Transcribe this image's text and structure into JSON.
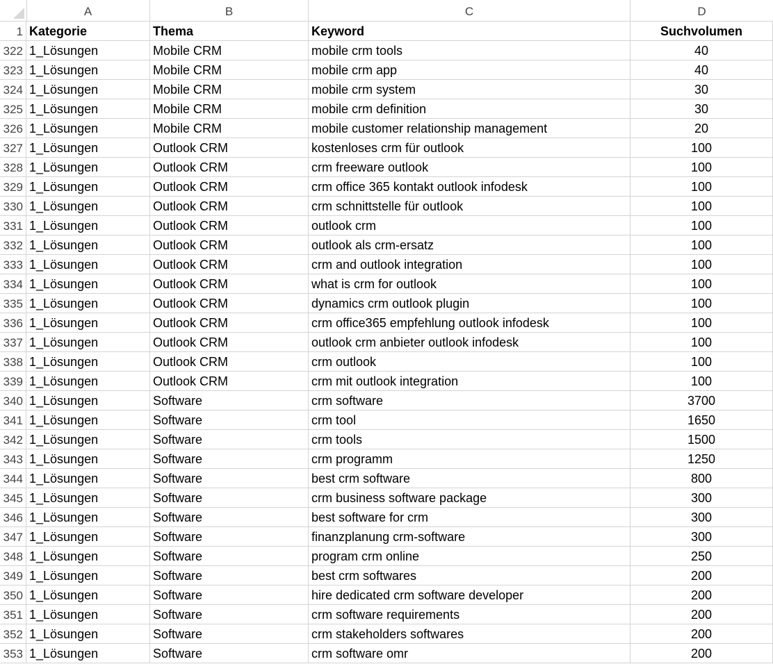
{
  "columns": [
    "A",
    "B",
    "C",
    "D"
  ],
  "header_row": {
    "row_number": "1",
    "cells": [
      "Kategorie",
      "Thema",
      "Keyword",
      "Suchvolumen"
    ]
  },
  "rows": [
    {
      "n": "322",
      "a": "1_Lösungen",
      "b": "Mobile CRM",
      "c": "mobile crm tools",
      "d": "40"
    },
    {
      "n": "323",
      "a": "1_Lösungen",
      "b": "Mobile CRM",
      "c": "mobile crm app",
      "d": "40"
    },
    {
      "n": "324",
      "a": "1_Lösungen",
      "b": "Mobile CRM",
      "c": "mobile crm system",
      "d": "30"
    },
    {
      "n": "325",
      "a": "1_Lösungen",
      "b": "Mobile CRM",
      "c": "mobile crm definition",
      "d": "30"
    },
    {
      "n": "326",
      "a": "1_Lösungen",
      "b": "Mobile CRM",
      "c": "mobile customer relationship management",
      "d": "20"
    },
    {
      "n": "327",
      "a": "1_Lösungen",
      "b": "Outlook CRM",
      "c": "kostenloses crm für outlook",
      "d": "100"
    },
    {
      "n": "328",
      "a": "1_Lösungen",
      "b": "Outlook CRM",
      "c": "crm freeware outlook",
      "d": "100"
    },
    {
      "n": "329",
      "a": "1_Lösungen",
      "b": "Outlook CRM",
      "c": "crm office 365 kontakt outlook infodesk",
      "d": "100"
    },
    {
      "n": "330",
      "a": "1_Lösungen",
      "b": "Outlook CRM",
      "c": "crm schnittstelle für outlook",
      "d": "100"
    },
    {
      "n": "331",
      "a": "1_Lösungen",
      "b": "Outlook CRM",
      "c": "outlook crm",
      "d": "100"
    },
    {
      "n": "332",
      "a": "1_Lösungen",
      "b": "Outlook CRM",
      "c": "outlook als crm-ersatz",
      "d": "100"
    },
    {
      "n": "333",
      "a": "1_Lösungen",
      "b": "Outlook CRM",
      "c": "crm and outlook integration",
      "d": "100"
    },
    {
      "n": "334",
      "a": "1_Lösungen",
      "b": "Outlook CRM",
      "c": "what is crm for outlook",
      "d": "100"
    },
    {
      "n": "335",
      "a": "1_Lösungen",
      "b": "Outlook CRM",
      "c": "dynamics crm outlook plugin",
      "d": "100"
    },
    {
      "n": "336",
      "a": "1_Lösungen",
      "b": "Outlook CRM",
      "c": "crm office365 empfehlung outlook infodesk",
      "d": "100"
    },
    {
      "n": "337",
      "a": "1_Lösungen",
      "b": "Outlook CRM",
      "c": "outlook crm anbieter outlook infodesk",
      "d": "100"
    },
    {
      "n": "338",
      "a": "1_Lösungen",
      "b": "Outlook CRM",
      "c": "crm outlook",
      "d": "100"
    },
    {
      "n": "339",
      "a": "1_Lösungen",
      "b": "Outlook CRM",
      "c": "crm mit outlook integration",
      "d": "100"
    },
    {
      "n": "340",
      "a": "1_Lösungen",
      "b": "Software",
      "c": "crm software",
      "d": "3700"
    },
    {
      "n": "341",
      "a": "1_Lösungen",
      "b": "Software",
      "c": "crm tool",
      "d": "1650"
    },
    {
      "n": "342",
      "a": "1_Lösungen",
      "b": "Software",
      "c": "crm tools",
      "d": "1500"
    },
    {
      "n": "343",
      "a": "1_Lösungen",
      "b": "Software",
      "c": "crm programm",
      "d": "1250"
    },
    {
      "n": "344",
      "a": "1_Lösungen",
      "b": "Software",
      "c": "best crm software",
      "d": "800"
    },
    {
      "n": "345",
      "a": "1_Lösungen",
      "b": "Software",
      "c": "crm business software package",
      "d": "300"
    },
    {
      "n": "346",
      "a": "1_Lösungen",
      "b": "Software",
      "c": "best software for crm",
      "d": "300"
    },
    {
      "n": "347",
      "a": "1_Lösungen",
      "b": "Software",
      "c": "finanzplanung crm-software",
      "d": "300"
    },
    {
      "n": "348",
      "a": "1_Lösungen",
      "b": "Software",
      "c": "program crm online",
      "d": "250"
    },
    {
      "n": "349",
      "a": "1_Lösungen",
      "b": "Software",
      "c": "best crm softwares",
      "d": "200"
    },
    {
      "n": "350",
      "a": "1_Lösungen",
      "b": "Software",
      "c": "hire dedicated crm software developer",
      "d": "200"
    },
    {
      "n": "351",
      "a": "1_Lösungen",
      "b": "Software",
      "c": "crm software requirements",
      "d": "200"
    },
    {
      "n": "352",
      "a": "1_Lösungen",
      "b": "Software",
      "c": "crm stakeholders softwares",
      "d": "200"
    },
    {
      "n": "353",
      "a": "1_Lösungen",
      "b": "Software",
      "c": "crm software omr",
      "d": "200"
    }
  ]
}
